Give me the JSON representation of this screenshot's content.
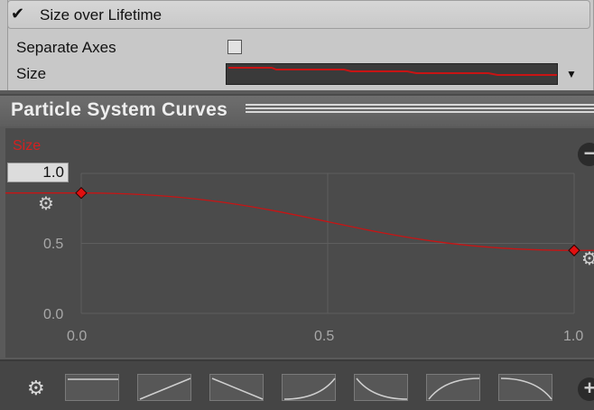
{
  "module": {
    "title": "Size over Lifetime",
    "enabled_mark": "✔",
    "separate_axes_label": "Separate Axes",
    "separate_axes_checked": false,
    "size_label": "Size",
    "dropdown_arrow": "▼"
  },
  "curves_window": {
    "title": "Particle System Curves",
    "curve_name": "Size",
    "max_value": "1.0",
    "y_ticks": [
      "0.5",
      "0.0"
    ],
    "x_ticks": [
      "0.0",
      "0.5",
      "1.0"
    ],
    "gear_glyph": "⚙",
    "remove_glyph": "−",
    "add_glyph": "+"
  },
  "colors": {
    "curve": "#c81414",
    "key": "#e01010",
    "label_red": "#d42020"
  },
  "icons": [
    "check-icon",
    "checkbox-icon",
    "dropdown-arrow-icon",
    "gear-icon",
    "remove-icon",
    "add-icon"
  ],
  "chart_data": {
    "type": "line",
    "x": [
      0.0,
      1.0
    ],
    "keyframes": [
      {
        "time": 0.0,
        "value": 0.86
      },
      {
        "time": 1.0,
        "value": 0.45
      }
    ],
    "xlim": [
      0.0,
      1.0
    ],
    "ylim": [
      0.0,
      1.0
    ],
    "x_ticks": [
      "0.0",
      "0.5",
      "1.0"
    ],
    "y_ticks": [
      "1.0",
      "0.5",
      "0.0"
    ],
    "grid": true,
    "series": [
      {
        "name": "Size",
        "values": [
          0.86,
          0.45
        ]
      }
    ]
  },
  "presets": [
    "flat",
    "linear-up",
    "linear-down",
    "ease-in",
    "ease-out-down",
    "ease-out-up",
    "ease-in-down"
  ]
}
